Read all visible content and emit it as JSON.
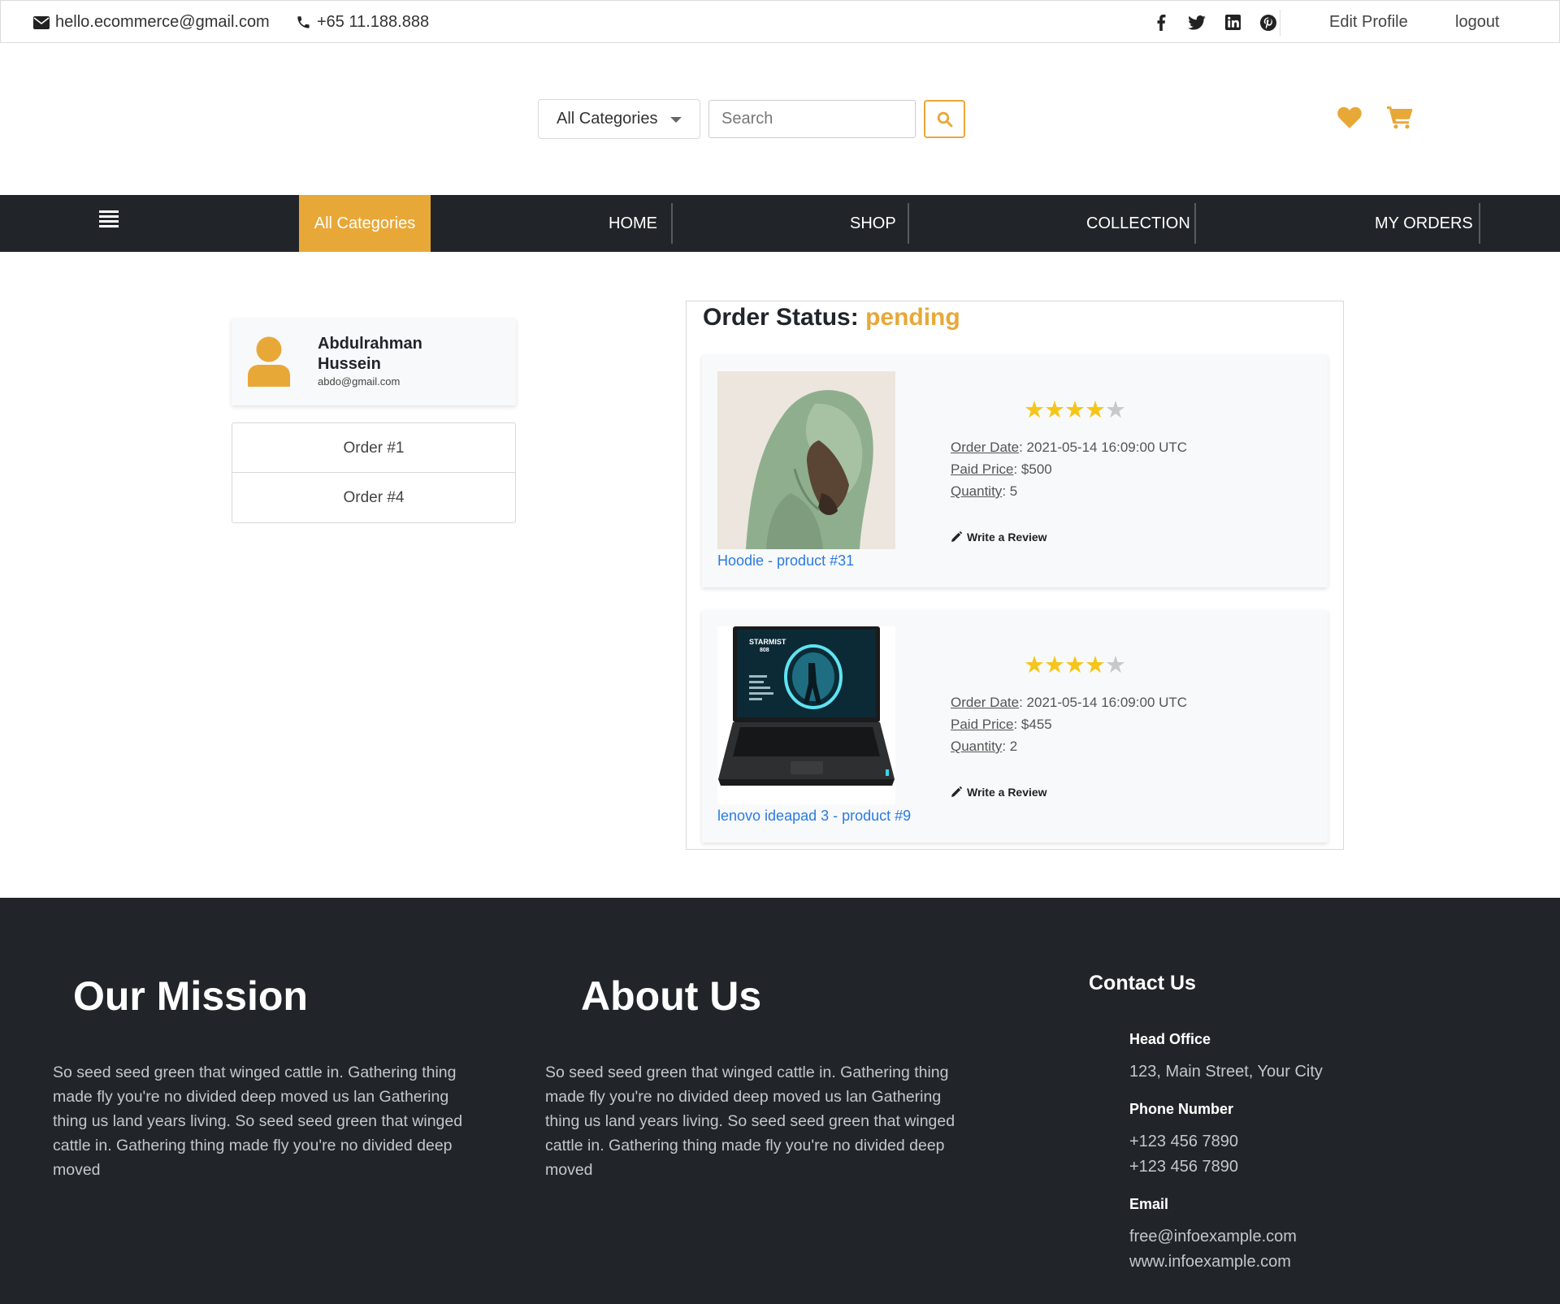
{
  "topbar": {
    "email": "hello.ecommerce@gmail.com",
    "phone": "+65 11.188.888",
    "edit_profile": "Edit Profile",
    "logout": "logout",
    "social_icons": [
      "facebook-icon",
      "twitter-icon",
      "linkedin-icon",
      "pinterest-icon"
    ]
  },
  "header": {
    "category_selected": "All Categories",
    "search_placeholder": "Search"
  },
  "nav": {
    "all_categories": "All Categories",
    "items": [
      "HOME",
      "SHOP",
      "COLLECTION",
      "MY ORDERS"
    ]
  },
  "profile": {
    "name": "Abdulrahman Hussein",
    "email": "abdo@gmail.com"
  },
  "orders": [
    "Order #1",
    "Order #4"
  ],
  "order_status": {
    "label": "Order Status:",
    "value": "pending"
  },
  "items": [
    {
      "product_link": "Hoodie - product #31",
      "rating": 4,
      "rating_max": 5,
      "order_date_label": "Order Date",
      "order_date": ": 2021-05-14 16:09:00 UTC",
      "paid_price_label": "Paid Price",
      "paid_price": ": $500",
      "quantity_label": "Quantity",
      "quantity": ": 5",
      "review": "Write a Review"
    },
    {
      "product_link": "lenovo ideapad 3 - product #9",
      "rating": 4,
      "rating_max": 5,
      "order_date_label": "Order Date",
      "order_date": ": 2021-05-14 16:09:00 UTC",
      "paid_price_label": "Paid Price",
      "paid_price": ": $455",
      "quantity_label": "Quantity",
      "quantity": ": 2",
      "review": "Write a Review",
      "screen_title": "STARMIST",
      "screen_subtitle": "808"
    }
  ],
  "footer": {
    "mission_title": "Our Mission",
    "mission_text": "So seed seed green that winged cattle in. Gathering thing made fly you're no divided deep moved us lan Gathering thing us land years living. So seed seed green that winged cattle in. Gathering thing made fly you're no divided deep moved",
    "about_title": "About Us",
    "about_text": "So seed seed green that winged cattle in. Gathering thing made fly you're no divided deep moved us lan Gathering thing us land years living. So seed seed green that winged cattle in. Gathering thing made fly you're no divided deep moved",
    "contact_title": "Contact Us",
    "head_office_label": "Head Office",
    "head_office": "123, Main Street, Your City",
    "phone_label": "Phone Number",
    "phone_1": "+123 456 7890",
    "phone_2": "+123 456 7890",
    "email_label": "Email",
    "email_1": "free@infoexample.com",
    "email_2": "www.infoexample.com"
  },
  "colors": {
    "accent": "#e8a838",
    "dark": "#212529",
    "link": "#2a7ae4",
    "star": "#f5c518"
  }
}
